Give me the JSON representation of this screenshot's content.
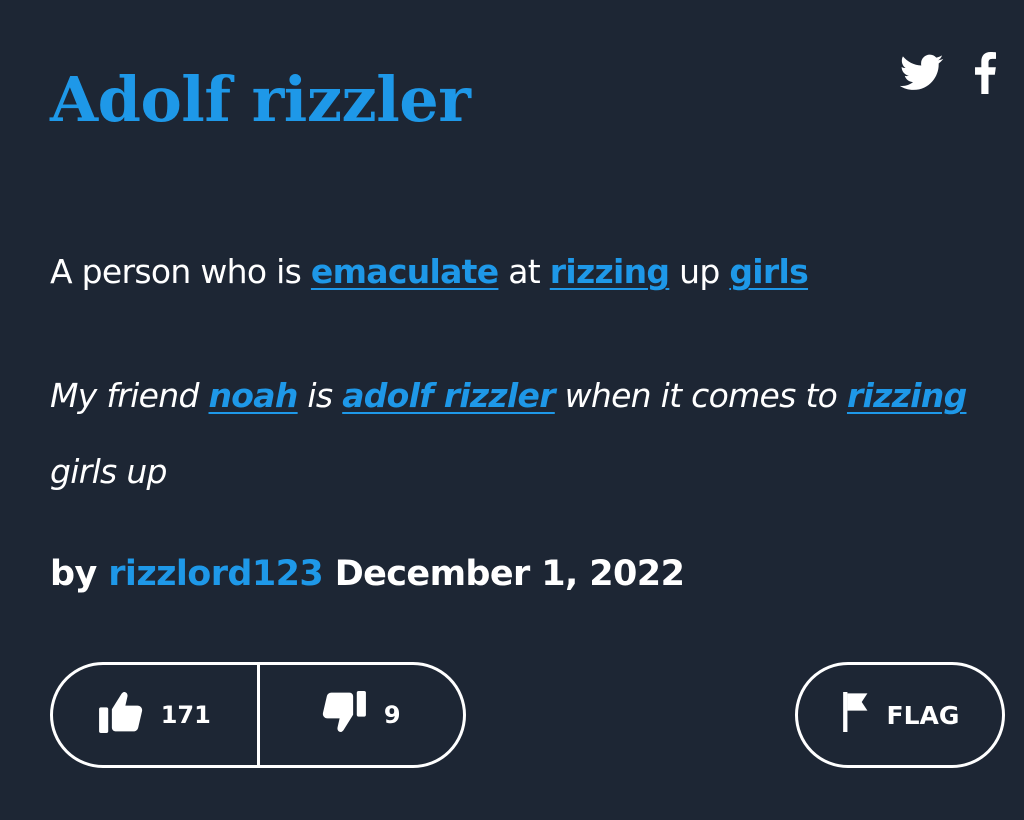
{
  "entry": {
    "word": "Adolf rizzler",
    "definition": {
      "t1": "A person who is ",
      "l1": "emaculate",
      "t2": " at ",
      "l2": "rizzing",
      "t3": " up ",
      "l3": "girls"
    },
    "example": {
      "t1": "My friend ",
      "l1": "noah",
      "t2": " is ",
      "l2": "adolf rizzler",
      "t3": " when it comes to ",
      "l3": "rizzing",
      "t4": " girls up"
    },
    "byline": {
      "by_label": "by",
      "author": "rizzlord123",
      "date": "December 1, 2022"
    }
  },
  "share": {
    "twitter_icon": "twitter-icon",
    "facebook_icon": "facebook-icon"
  },
  "votes": {
    "up_count": "171",
    "down_count": "9"
  },
  "flag": {
    "label": "FLAG"
  },
  "colors": {
    "background": "#1d2634",
    "accent": "#1e98e8",
    "text": "#ffffff"
  }
}
